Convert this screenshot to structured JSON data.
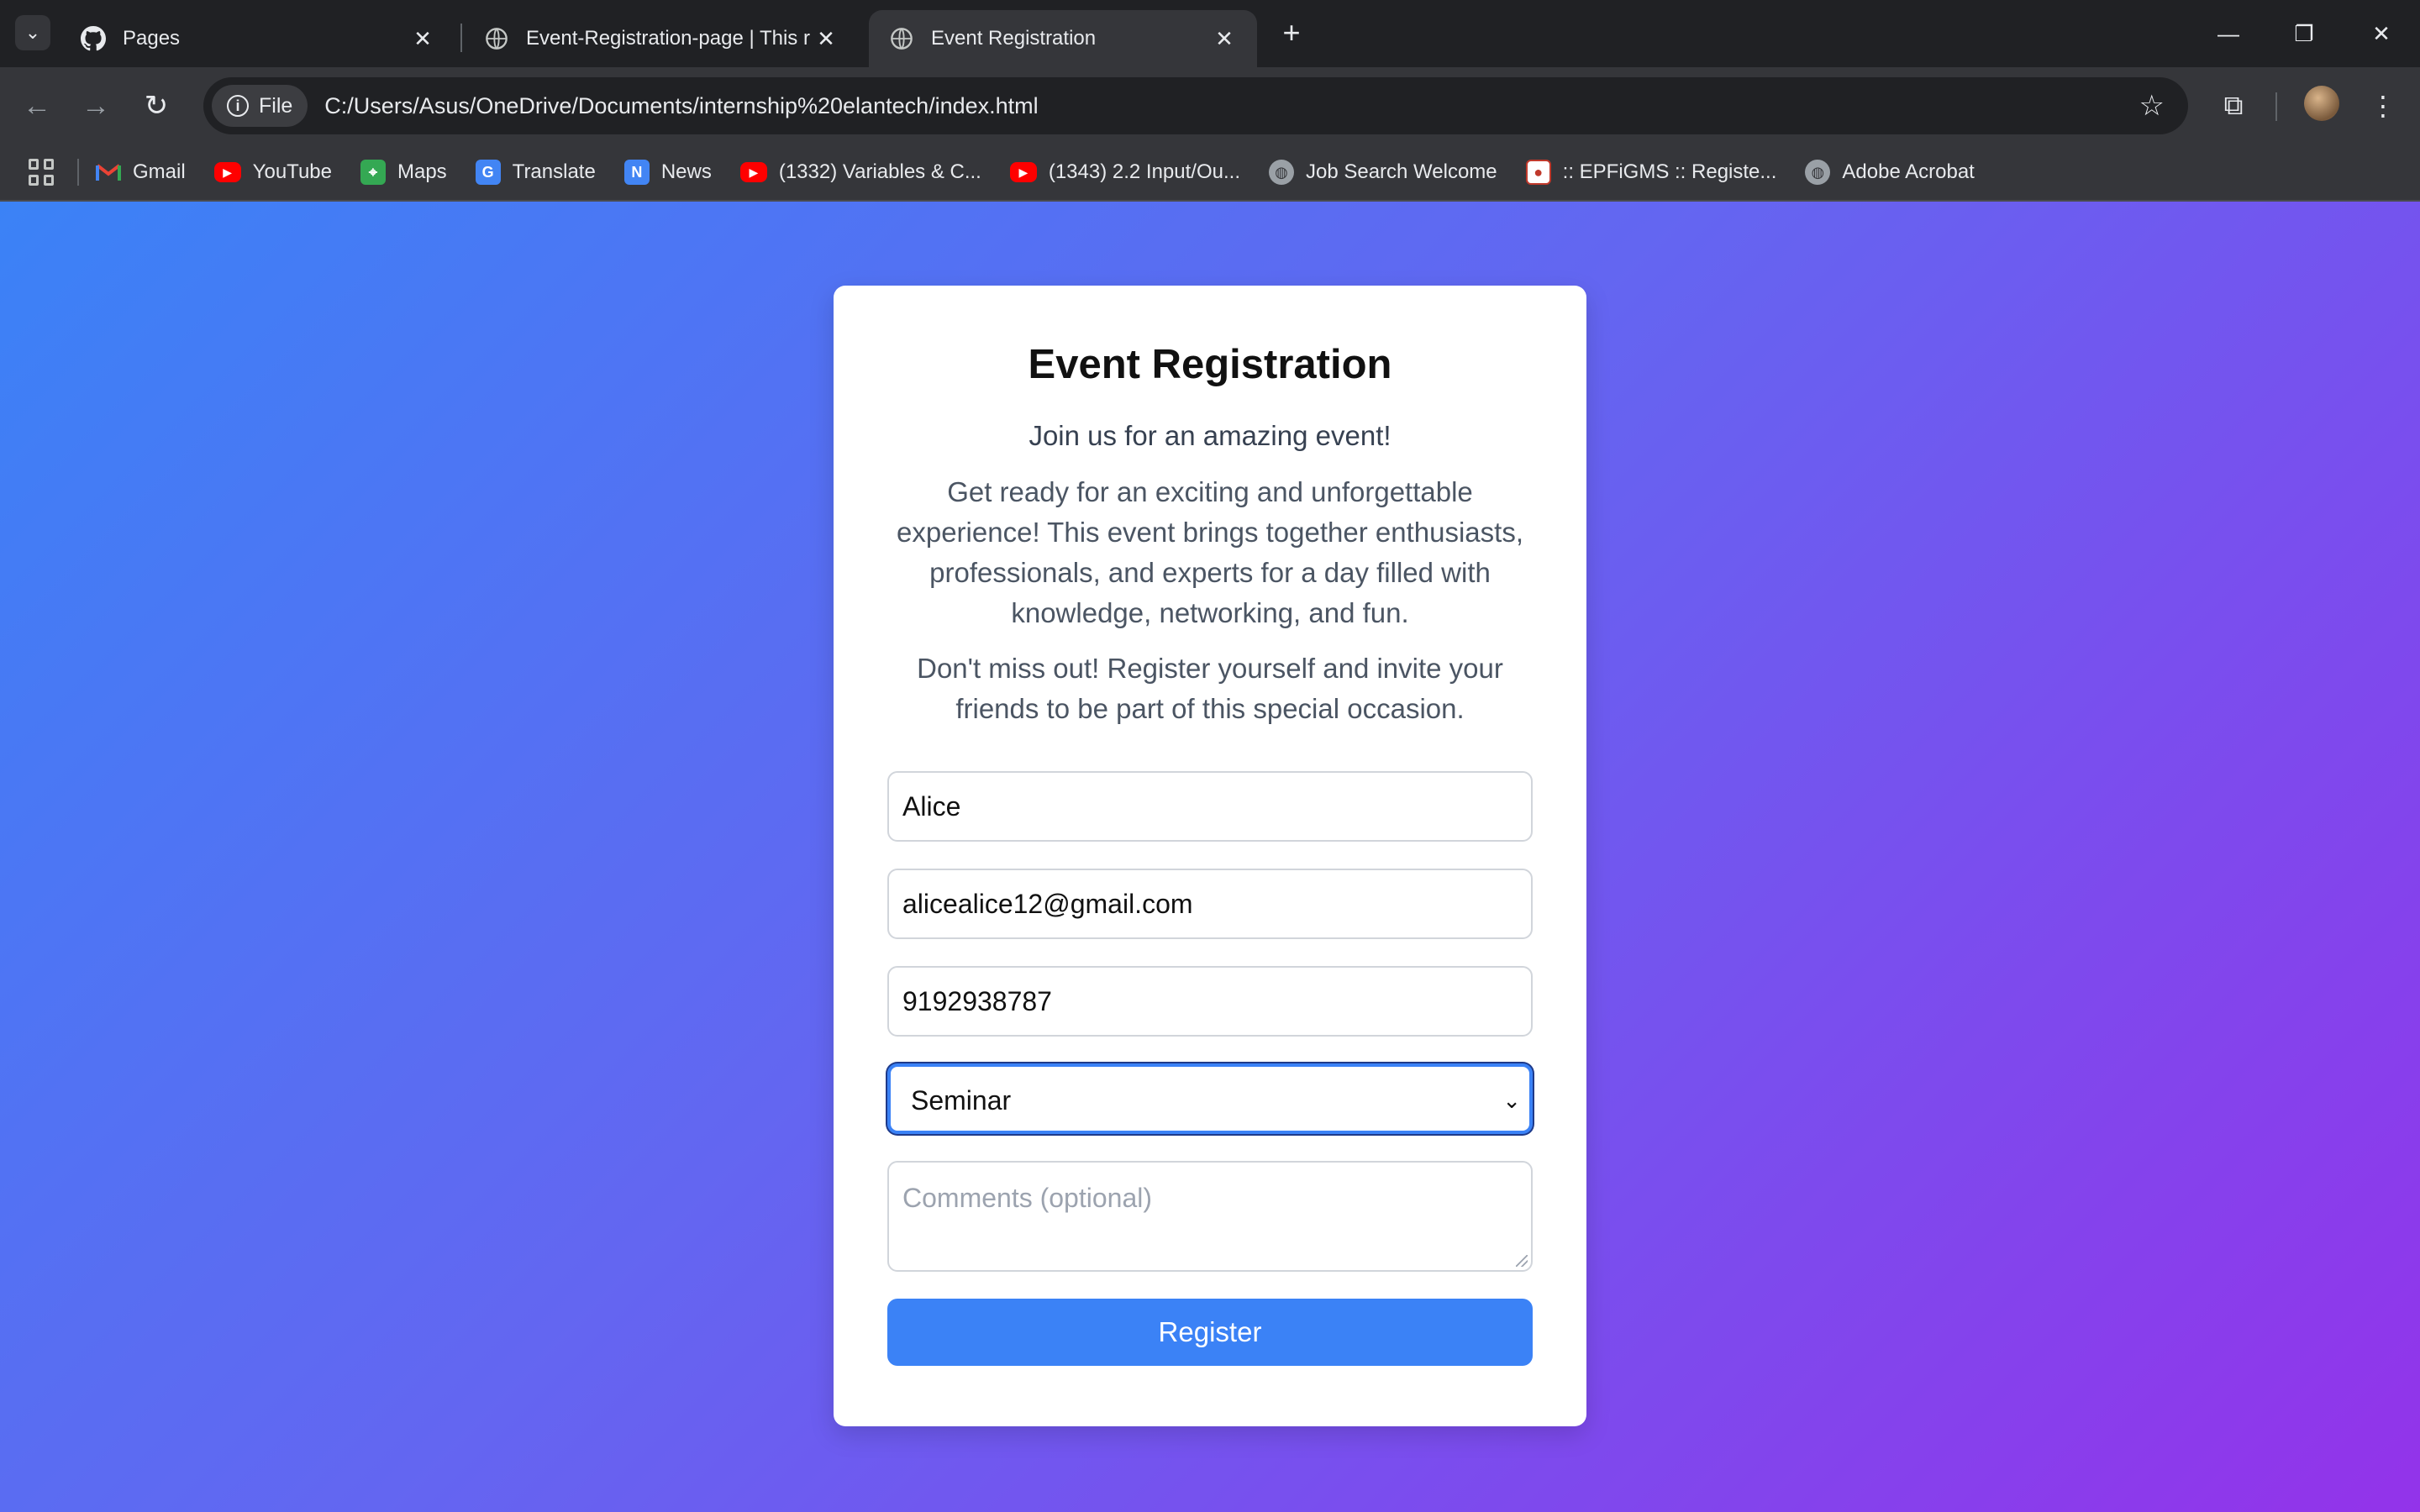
{
  "browser": {
    "tabs": [
      {
        "title": "Pages",
        "icon": "github-icon"
      },
      {
        "title": "Event-Registration-page | This r",
        "icon": "globe-icon"
      },
      {
        "title": "Event Registration",
        "icon": "globe-icon",
        "active": true
      }
    ],
    "address": {
      "chip": "File",
      "url": "C:/Users/Asus/OneDrive/Documents/internship%20elantech/index.html"
    },
    "bookmarks": [
      {
        "label": "Gmail",
        "icon": "gmail-icon"
      },
      {
        "label": "YouTube",
        "icon": "youtube-icon"
      },
      {
        "label": "Maps",
        "icon": "maps-icon"
      },
      {
        "label": "Translate",
        "icon": "translate-icon"
      },
      {
        "label": "News",
        "icon": "news-icon"
      },
      {
        "label": "(1332) Variables & C...",
        "icon": "youtube-icon"
      },
      {
        "label": "(1343) 2.2 Input/Ou...",
        "icon": "youtube-icon"
      },
      {
        "label": "Job Search Welcome",
        "icon": "globe-icon"
      },
      {
        "label": ":: EPFiGMS :: Registe...",
        "icon": "epfigms-icon"
      },
      {
        "label": "Adobe Acrobat",
        "icon": "globe-icon"
      }
    ]
  },
  "page": {
    "title": "Event Registration",
    "tagline": "Join us for an amazing event!",
    "description": "Get ready for an exciting and unforgettable experience! This event brings together enthusiasts, professionals, and experts for a day filled with knowledge, networking, and fun.",
    "invite": "Don't miss out! Register yourself and invite your friends to be part of this special occasion.",
    "form": {
      "name_value": "Alice",
      "email_value": "alicealice12@gmail.com",
      "phone_value": "9192938787",
      "event_type_value": "Seminar",
      "comments_placeholder": "Comments (optional)",
      "submit_label": "Register"
    }
  },
  "colors": {
    "gradient_start": "#3b82f6",
    "gradient_end": "#9333ea",
    "button": "#3b82f6"
  }
}
